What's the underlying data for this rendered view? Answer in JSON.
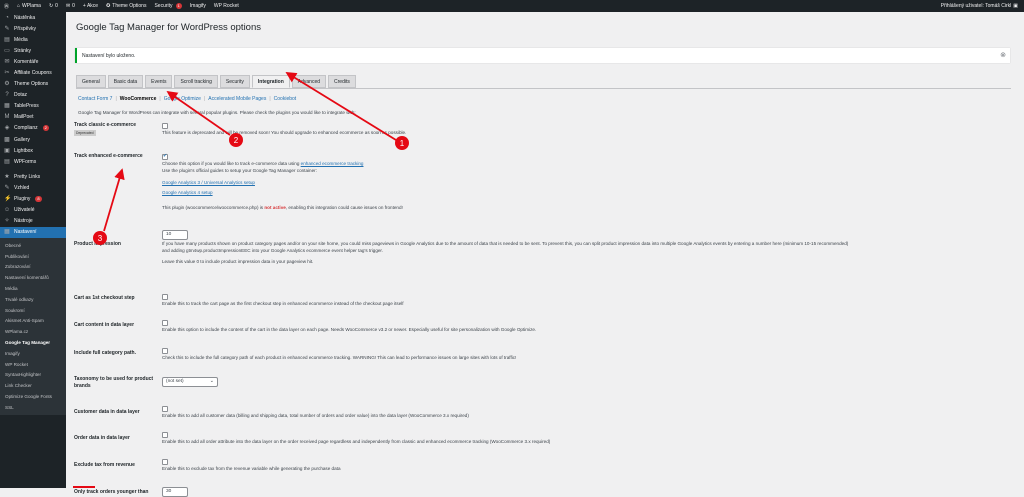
{
  "adminbar": {
    "site": "WPlama",
    "comments": "0",
    "new": "+ Akce",
    "theme_options": "Theme Options",
    "security": "Security",
    "security_count": "1",
    "imagify": "Imagify",
    "wp_rocket": "WP Rocket",
    "user": "Přihlášený uživatel: Tomáš Cirkl",
    "updates": "0"
  },
  "sidebar": {
    "items": [
      {
        "label": "Nástěnka",
        "icon": "dashboard-icon"
      },
      {
        "label": "Příspěvky",
        "icon": "pin-icon"
      },
      {
        "label": "Média",
        "icon": "media-icon"
      },
      {
        "label": "Stránky",
        "icon": "page-icon"
      },
      {
        "label": "Komentáře",
        "icon": "comment-icon"
      },
      {
        "label": "Affiliate Coupons",
        "icon": "ticket-icon"
      },
      {
        "label": "Theme Options",
        "icon": "gear-icon"
      },
      {
        "label": "Dotaz",
        "icon": "question-icon"
      },
      {
        "label": "TablePress",
        "icon": "table-icon"
      },
      {
        "label": "MailPoet",
        "icon": "mail-icon"
      },
      {
        "label": "Complianz",
        "icon": "shield-icon",
        "badge": "2"
      },
      {
        "label": "Gallery",
        "icon": "gallery-icon"
      },
      {
        "label": "Lightbox",
        "icon": "lightbox-icon"
      },
      {
        "label": "WPForms",
        "icon": "form-icon"
      },
      {
        "label": "Pretty Links",
        "icon": "link-icon"
      },
      {
        "label": "Vzhled",
        "icon": "brush-icon"
      },
      {
        "label": "Pluginy",
        "icon": "plugin-icon",
        "badge": "8"
      },
      {
        "label": "Uživatelé",
        "icon": "user-icon"
      },
      {
        "label": "Nástroje",
        "icon": "wrench-icon"
      },
      {
        "label": "Nastavení",
        "icon": "settings-icon"
      }
    ],
    "submenu": [
      "Obecné",
      "Publikování",
      "Zobrazování",
      "Nastavení komentářů",
      "Média",
      "Trvalé odkazy",
      "Soukromí",
      "Akismet Anti-Spam",
      "WPlama.cz",
      "Google Tag Manager",
      "Imagify",
      "WP Rocket",
      "SyntaxHighlighter",
      "Link Checker",
      "Optimize Google Fonts",
      "SSL"
    ]
  },
  "page": {
    "title": "Google Tag Manager for WordPress options",
    "notice": "Nastavení bylo uloženo.",
    "tabs": [
      "General",
      "Basic data",
      "Events",
      "Scroll tracking",
      "Security",
      "Integration",
      "Advanced",
      "Credits"
    ],
    "subtabs": [
      "Contact Form 7",
      "WooCommerce",
      "Google Optimize",
      "Accelerated Mobile Pages",
      "Cookiebot"
    ],
    "intro": "Google Tag Manager for WordPress can integrate with several popular plugins. Please check the plugins you would like to integrate with:"
  },
  "rows": {
    "track_classic": {
      "label": "Track classic e-commerce",
      "tag": "Deprecated",
      "desc": "This feature is deprecated and will be removed soon! You should upgrade to enhanced ecommerce as soon as possible."
    },
    "track_enhanced": {
      "label": "Track enhanced e-commerce",
      "desc1": "Choose this option if you would like to track e-commerce data using ",
      "link": "enhanced ecommerce tracking",
      "desc2": "Use the plugin's official guides to setup your Google Tag Manager container:",
      "guide1": "Google Analytics 3 / Universal Analytics setup",
      "guide2": "Google Analytics 4 setup",
      "warn_pre": "This plugin (woocommerce/woocommerce.php) is ",
      "warn_red": "not active",
      "warn_post": ", enabling this integration could cause issues on frontend!"
    },
    "impression": {
      "label": "Product impression",
      "value": "10",
      "desc1": "If you have many products shown on product category pages and/or on your site home, you could miss pageviews in Google Analytics due to the amount of data that is needed to be sent. To prevent this, you can split product impression data into multiple Google Analytics events by entering a number here (minimum 10-15 recommended)",
      "desc2": "and adding gtm4wp.productImpressionEEC into your Google Analytics ecommerce event helper tag's trigger.",
      "desc3": "Leave this value 0 to include product impression data in your pageview hit."
    },
    "cart_first": {
      "label": "Cart as 1st checkout step",
      "desc": "Enable this to track the cart page as the first checkout step in enhanced ecommerce instead of the checkout page itself"
    },
    "cart_content": {
      "label": "Cart content in data layer",
      "desc": "Enable this option to include the content of the cart in the data layer on each page. Needs WooCommerce v3.2 or newer. Especially useful for site personalization with Google Optimize."
    },
    "full_category": {
      "label": "Include full category path.",
      "desc": "Check this to include the full category path of each product in enhanced ecommerce tracking. WARNING! This can lead to performance issues on large sites with lots of traffic!"
    },
    "taxonomy": {
      "label": "Taxonomy to be used for product brands",
      "value": "(not set)"
    },
    "customer_data": {
      "label": "Customer data in data layer",
      "desc": "Enable this to add all customer data (billing and shipping data, total number of orders and order value) into the data layer (WooCommerce 3.x required)"
    },
    "order_data": {
      "label": "Order data in data layer",
      "desc": "Enable this to add all order attribute into the data layer on the order received page regardless and independently from classic and enhanced ecommerce tracking (WooCommerce 3.x required)"
    },
    "exclude_tax": {
      "label": "Exclude tax from revenue",
      "desc": "Enable this to exclude tax from the revenue variable while generating the purchase data"
    },
    "younger": {
      "label": "Only track orders younger than",
      "value": "30"
    }
  },
  "annotations": [
    "1",
    "2",
    "3"
  ],
  "colors": {
    "accent": "#2271b1",
    "annotation": "#e50914"
  }
}
